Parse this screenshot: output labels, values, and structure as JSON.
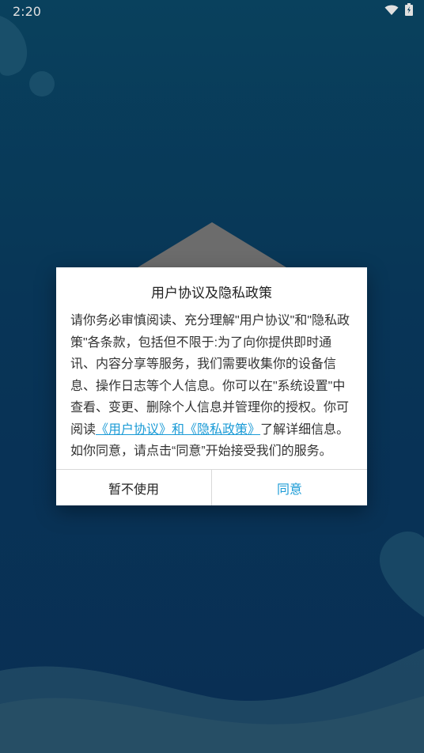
{
  "status": {
    "time": "2:20",
    "icons": [
      "wifi-icon",
      "battery-icon"
    ]
  },
  "colors": {
    "background": "#0b3d63",
    "accent": "#1b9bd6",
    "dialog_bg": "#ffffff"
  },
  "dialog": {
    "title": "用户协议及隐私政策",
    "body_part1": "请你务必审慎阅读、充分理解\"用户协议\"和\"隐私政策\"各条款，包括但不限于:为了向你提供即时通讯、内容分享等服务，我们需要收集你的设备信息、操作日志等个人信息。你可以在\"系统设置\"中查看、变更、删除个人信息并管理你的授权。你可阅读",
    "link_user_agreement": "《用户协议》",
    "and_text": "和",
    "link_privacy_policy": "《隐私政策》",
    "body_part2": "了解详细信息。如你同意，请点击“同意”开始接受我们的服务。",
    "cancel_label": "暂不使用",
    "agree_label": "同意"
  }
}
